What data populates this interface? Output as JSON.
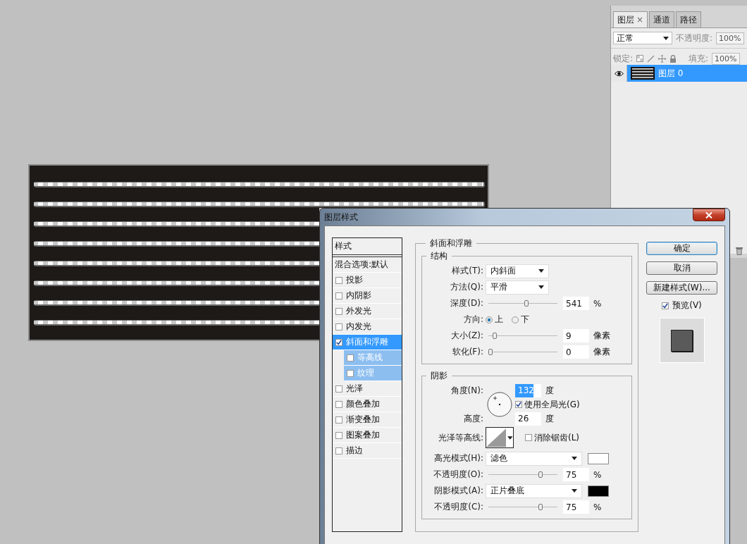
{
  "layers_panel": {
    "tabs": [
      {
        "label": "图层",
        "selected": true,
        "close": "×"
      },
      {
        "label": "通道",
        "selected": false
      },
      {
        "label": "路径",
        "selected": false
      }
    ],
    "blend_mode": "正常",
    "opacity_label": "不透明度:",
    "opacity": "100%",
    "lock_label": "锁定:",
    "fill_label": "填充:",
    "fill": "100%",
    "layers": [
      {
        "name": "图层 0",
        "selected": true,
        "visible": true
      }
    ]
  },
  "dialog": {
    "title": "图层样式",
    "styles_header": "样式",
    "blend_options": "混合选项:默认",
    "styles": [
      {
        "label": "投影",
        "checked": false,
        "selected": false
      },
      {
        "label": "内阴影",
        "checked": false,
        "selected": false
      },
      {
        "label": "外发光",
        "checked": false,
        "selected": false
      },
      {
        "label": "内发光",
        "checked": false,
        "selected": false
      },
      {
        "label": "斜面和浮雕",
        "checked": true,
        "selected": true,
        "children": [
          {
            "label": "等高线",
            "checked": false
          },
          {
            "label": "纹理",
            "checked": false
          }
        ]
      },
      {
        "label": "光泽",
        "checked": false,
        "selected": false
      },
      {
        "label": "颜色叠加",
        "checked": false,
        "selected": false
      },
      {
        "label": "渐变叠加",
        "checked": false,
        "selected": false
      },
      {
        "label": "图案叠加",
        "checked": false,
        "selected": false
      },
      {
        "label": "描边",
        "checked": false,
        "selected": false
      }
    ],
    "section_title": "斜面和浮雕",
    "structure": {
      "title": "结构",
      "style": {
        "label": "样式(T):",
        "value": "内斜面"
      },
      "technique": {
        "label": "方法(Q):",
        "value": "平滑"
      },
      "depth": {
        "label": "深度(D):",
        "level": 0.55,
        "value": "541",
        "unit": "%"
      },
      "direction": {
        "label": "方向:",
        "options": [
          {
            "label": "上",
            "selected": true
          },
          {
            "label": "下",
            "selected": false
          }
        ]
      },
      "size": {
        "label": "大小(Z):",
        "level": 0.07,
        "value": "9",
        "unit": "像素"
      },
      "soften": {
        "label": "软化(F):",
        "level": 0,
        "value": "0",
        "unit": "像素"
      }
    },
    "shading": {
      "title": "阴影",
      "angle": {
        "label": "角度(N):",
        "value": "132",
        "unit": "度"
      },
      "global_light": {
        "label": "使用全局光(G)",
        "checked": true
      },
      "altitude": {
        "label": "高度:",
        "value": "26",
        "unit": "度"
      },
      "gloss_contour": {
        "label": "光泽等高线:"
      },
      "anti_aliased": {
        "label": "消除锯齿(L)",
        "checked": false
      },
      "highlight_mode": {
        "label": "高光模式(H):",
        "value": "滤色",
        "color": "#ffffff"
      },
      "highlight_opacity": {
        "label": "不透明度(O):",
        "level": 0.77,
        "value": "75",
        "unit": "%"
      },
      "shadow_mode": {
        "label": "阴影模式(A):",
        "value": "正片叠底",
        "color": "#000000"
      },
      "shadow_opacity": {
        "label": "不透明度(C):",
        "level": 0.77,
        "value": "75",
        "unit": "%"
      }
    },
    "buttons": [
      {
        "label": "确定",
        "default": true
      },
      {
        "label": "取消",
        "default": false
      },
      {
        "label": "新建样式(W)...",
        "default": false
      }
    ],
    "preview": {
      "label": "预览(V)",
      "checked": true
    }
  }
}
